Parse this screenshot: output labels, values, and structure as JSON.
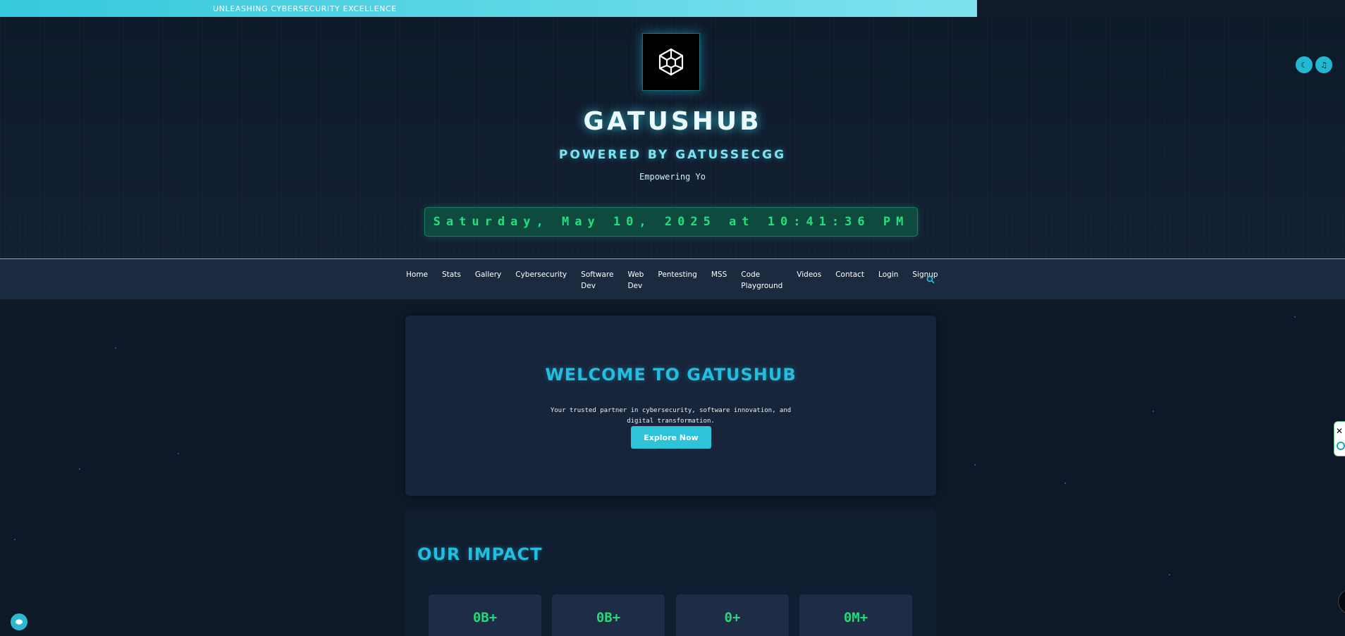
{
  "banner": {
    "text": "UNLEASHING CYBERSECURITY EXCELLENCE"
  },
  "header": {
    "title": "GATUSHUB",
    "subtitle": "POWERED BY GATUSSECGG",
    "tagline": "Empowering Yo",
    "datetime": "Saturday, May 10, 2025 at 10:41:36 PM",
    "toggles": {
      "theme_icon": "moon-icon",
      "music_icon": "music-note-icon"
    }
  },
  "nav": {
    "items": [
      "Home",
      "Stats",
      "Gallery",
      "Cybersecurity",
      "Software\nDev",
      "Web\nDev",
      "Pentesting",
      "MSS",
      "Code\nPlayground",
      "Videos",
      "Contact",
      "Login",
      "Signup"
    ],
    "search_icon": "search-icon"
  },
  "welcome": {
    "title": "WELCOME TO GATUSHUB",
    "text": "Your trusted partner in cybersecurity, software innovation, and digital transformation.",
    "button": "Explore Now"
  },
  "impact": {
    "title": "OUR IMPACT",
    "stats": [
      "0B+",
      "0B+",
      "0+",
      "0M+"
    ]
  },
  "colors": {
    "accent": "#20bfe0",
    "clock_text": "#22e07e",
    "stat_text": "#25d978",
    "background": "#0f1a2a"
  }
}
